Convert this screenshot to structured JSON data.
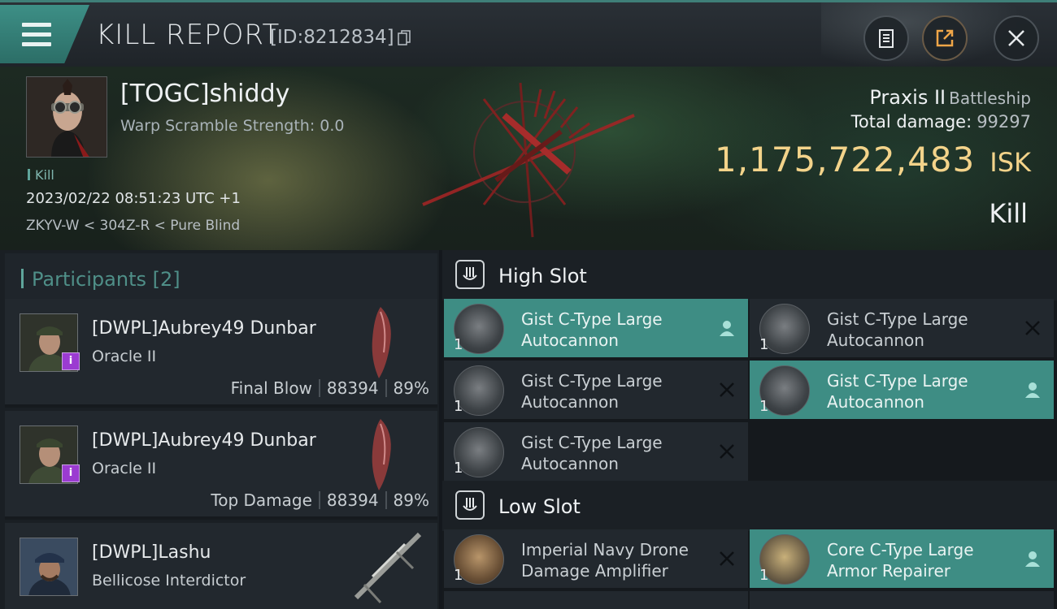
{
  "header": {
    "title": "KILL REPORT",
    "report_id": "[ID:8212834]",
    "buttons": [
      "clipboard-icon",
      "share-icon",
      "close-icon"
    ]
  },
  "victim": {
    "name": "[TOGC]shiddy",
    "warp_scramble": "Warp Scramble Strength: 0.0",
    "tag": "Kill",
    "datetime": "2023/02/22 08:51:23 UTC +1",
    "location": "ZKYV-W < 304Z-R < Pure Blind",
    "ship": "Praxis II",
    "ship_class": "Battleship",
    "total_damage_label": "Total damage:",
    "total_damage": "99297",
    "isk_value": "1,175,722,483",
    "isk_unit": "ISK",
    "result": "Kill"
  },
  "participants": {
    "header": "Participants [2]",
    "rows": [
      {
        "name": "[DWPL]Aubrey49 Dunbar",
        "ship": "Oracle II",
        "role": "Final Blow",
        "damage": "88394",
        "percent": "89%",
        "badge": "i"
      },
      {
        "name": "[DWPL]Aubrey49 Dunbar",
        "ship": "Oracle II",
        "role": "Top Damage",
        "damage": "88394",
        "percent": "89%",
        "badge": "i"
      },
      {
        "name": "[DWPL]Lashu",
        "ship": "Bellicose Interdictor",
        "role": "",
        "damage": "",
        "percent": "",
        "badge": ""
      }
    ]
  },
  "slots": {
    "high": {
      "title": "High Slot",
      "items": [
        {
          "name": "Gist C-Type Large Autocannon",
          "qty": "1",
          "status": "dropped"
        },
        {
          "name": "Gist C-Type Large Autocannon",
          "qty": "1",
          "status": "destroyed"
        },
        {
          "name": "Gist C-Type Large Autocannon",
          "qty": "1",
          "status": "destroyed"
        },
        {
          "name": "Gist C-Type Large Autocannon",
          "qty": "1",
          "status": "dropped"
        },
        {
          "name": "Gist C-Type Large Autocannon",
          "qty": "1",
          "status": "destroyed"
        }
      ]
    },
    "low": {
      "title": "Low Slot",
      "items": [
        {
          "name": "Imperial Navy Drone Damage Amplifier",
          "qty": "1",
          "status": "destroyed"
        },
        {
          "name": "Core C-Type Large Armor Repairer",
          "qty": "1",
          "status": "dropped"
        }
      ]
    }
  },
  "colors": {
    "accent": "#3e8d84",
    "isk": "#f3d38a",
    "badge": "#9b3bd1"
  }
}
